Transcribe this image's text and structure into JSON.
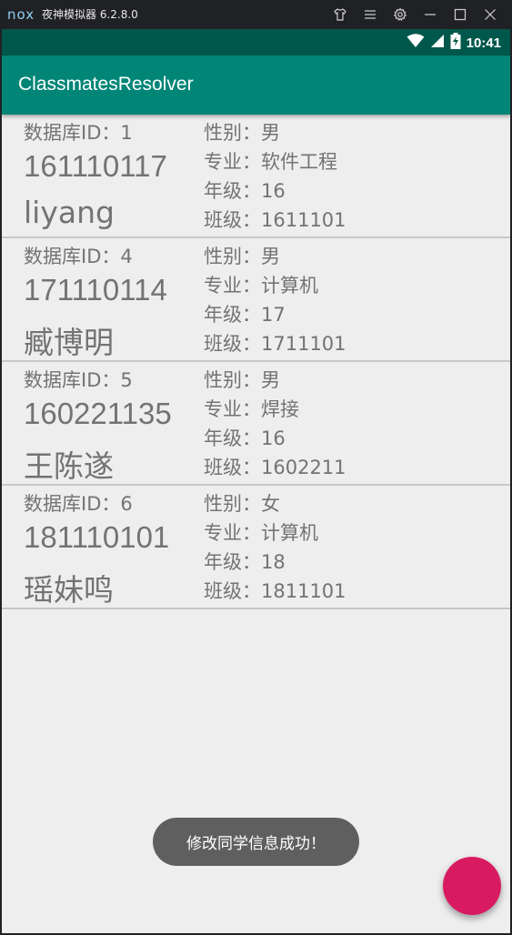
{
  "emulator": {
    "logo": "nox",
    "title": "夜神模拟器 6.2.8.0",
    "icons": [
      "shirt-icon",
      "menu-icon",
      "gear-icon",
      "minimize-icon",
      "maximize-icon",
      "close-icon"
    ]
  },
  "status_bar": {
    "time": "10:41",
    "icons": [
      "wifi-icon",
      "signal-icon",
      "battery-charging-icon"
    ]
  },
  "app_bar": {
    "title": "ClassmatesResolver"
  },
  "students": [
    {
      "db_id": "数据库ID：1",
      "student_no": "161110117",
      "name": "liyang",
      "gender": "性别：男",
      "major": "专业：软件工程",
      "grade": "年级：16",
      "class": "班级：1611101"
    },
    {
      "db_id": "数据库ID：4",
      "student_no": "171110114",
      "name": "臧博明",
      "gender": "性别：男",
      "major": "专业：计算机",
      "grade": "年级：17",
      "class": "班级：1711101"
    },
    {
      "db_id": "数据库ID：5",
      "student_no": "160221135",
      "name": "王陈遂",
      "gender": "性别：男",
      "major": "专业：焊接",
      "grade": "年级：16",
      "class": "班级：1602211"
    },
    {
      "db_id": "数据库ID：6",
      "student_no": "181110101",
      "name": "瑶妹鸣",
      "gender": "性别：女",
      "major": "专业：计算机",
      "grade": "年级：18",
      "class": "班级：1811101"
    }
  ],
  "toast": {
    "message": "修改同学信息成功！"
  },
  "colors": {
    "app_bar": "#008577",
    "status_bar": "#00574b",
    "fab": "#d81b60",
    "background": "#eeeeee"
  }
}
